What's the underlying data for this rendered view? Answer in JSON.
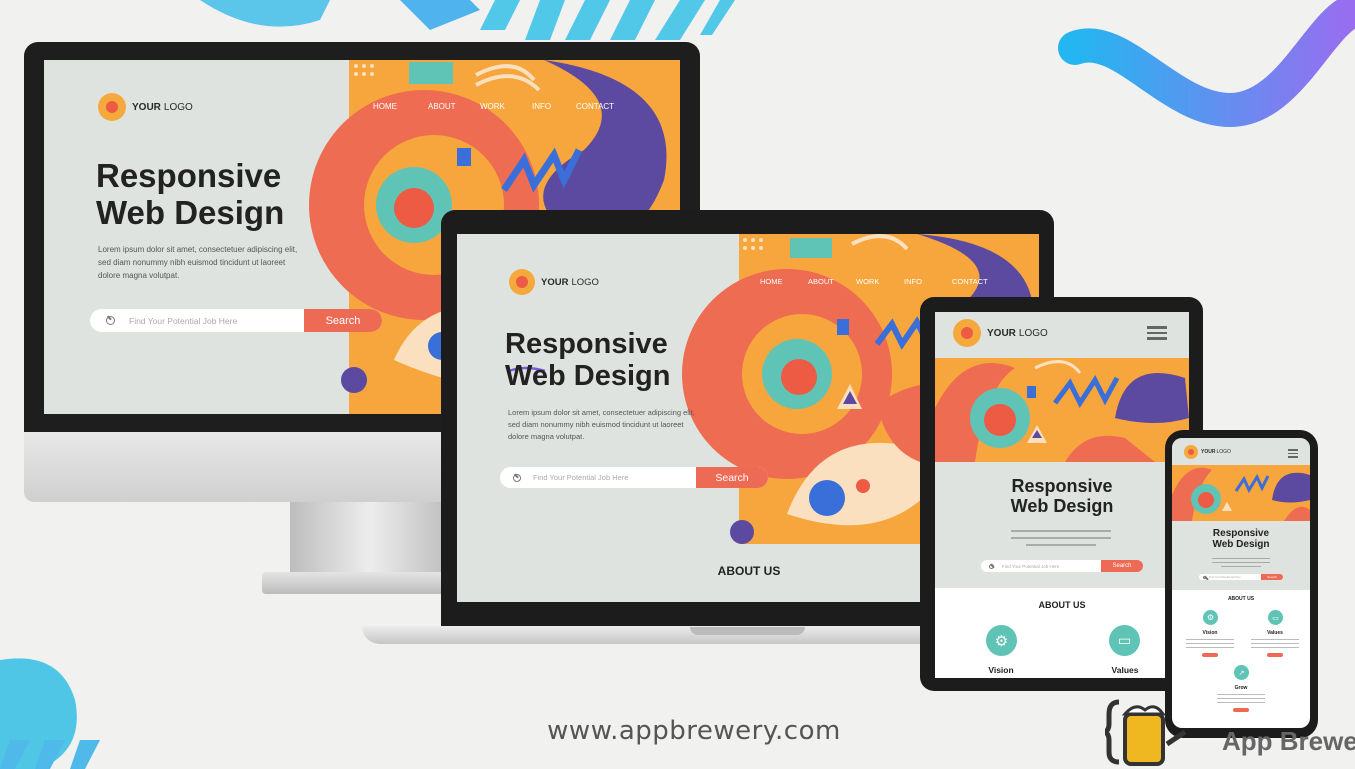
{
  "site": {
    "logo_bold": "YOUR",
    "logo_light": "LOGO",
    "nav": [
      "HOME",
      "ABOUT",
      "WORK",
      "INFO",
      "CONTACT"
    ],
    "headline_line1": "Responsive",
    "headline_line2": "Web Design",
    "paragraph_line1": "Lorem ipsum dolor sit amet, consectetuer adipiscing elit,",
    "paragraph_line2": "sed diam nonummy nibh euismod tincidunt ut laoreet",
    "paragraph_line3": "dolore magna volutpat.",
    "search_placeholder": "Find Your Potential Job Here",
    "search_button": "Search",
    "about_title": "ABOUT US",
    "features": [
      "Vision",
      "Values",
      "Grow"
    ]
  },
  "footer": {
    "url": "www.appbrewery.com",
    "brand": "App Brewe"
  },
  "colors": {
    "background": "#f1f1f0",
    "screen_bg": "#dfe3df",
    "accent_orange": "#f5a93c",
    "accent_red": "#ee5b45",
    "accent_teal": "#5fc4b5",
    "accent_purple": "#5b4aa0",
    "accent_blue": "#4fb4ee"
  }
}
